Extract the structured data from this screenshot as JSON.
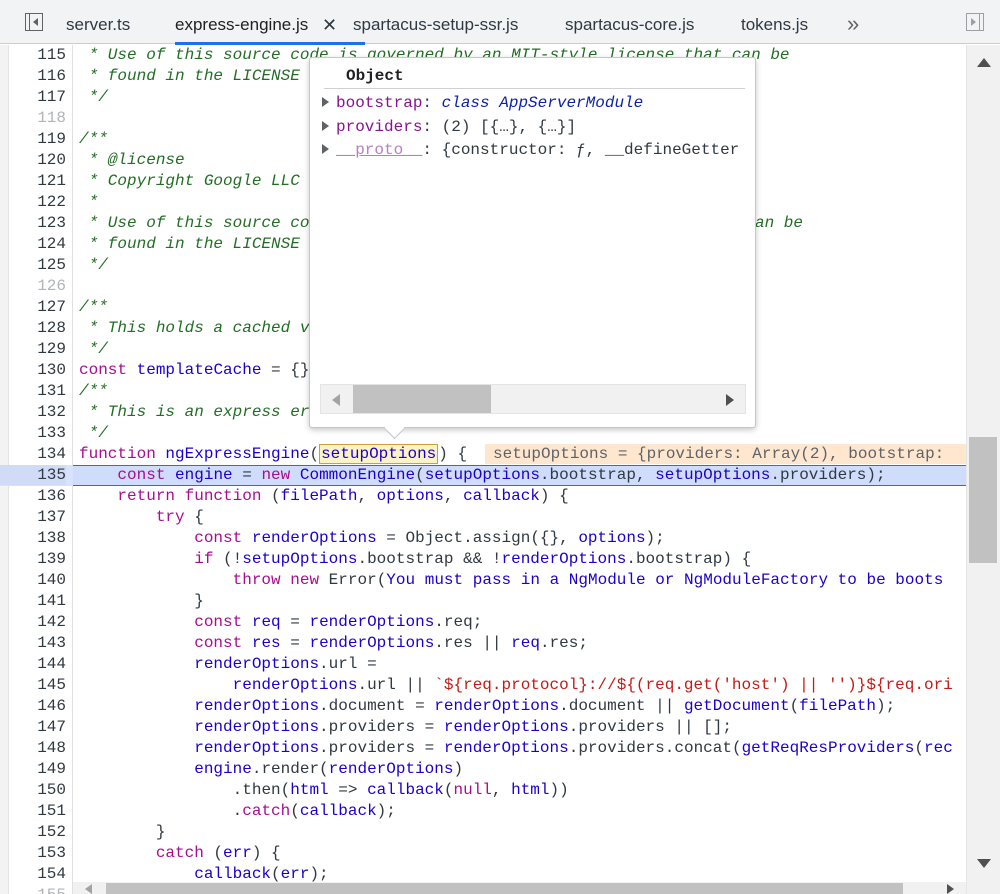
{
  "tabs": [
    {
      "label": "server.ts"
    },
    {
      "label": "express-engine.js",
      "active": true
    },
    {
      "label": "spartacus-setup-ssr.js"
    },
    {
      "label": "spartacus-core.js"
    },
    {
      "label": "tokens.js"
    }
  ],
  "tabbar": {
    "close_glyph": "✕",
    "more_glyph": "»",
    "left_toggle_icon": "toggle-navigator-icon",
    "right_toggle_icon": "toggle-debugger-icon"
  },
  "popover": {
    "title": "Object",
    "props": [
      {
        "key": "bootstrap",
        "sep": ": ",
        "type": "class",
        "value": " AppServerModule"
      },
      {
        "key": "providers",
        "sep": ": ",
        "type": "",
        "value": "(2) [{…}, {…}]"
      },
      {
        "key": "__proto__",
        "sep": ": ",
        "type": "",
        "value": "{constructor: ƒ, __defineGetter"
      }
    ]
  },
  "inline_value": "setupOptions = {providers: Array(2), bootstrap: ",
  "hover_word": "setupOptions",
  "lines": [
    {
      "n": "115",
      "t": " * Use of this source code is governed by an MIT-style license that can be"
    },
    {
      "n": "116",
      "t": " * found in the LICENSE"
    },
    {
      "n": "117",
      "t": " */"
    },
    {
      "n": "118",
      "t": ""
    },
    {
      "n": "119",
      "t": "/**"
    },
    {
      "n": "120",
      "t": " * @license"
    },
    {
      "n": "121",
      "t": " * Copyright Google LLC"
    },
    {
      "n": "122",
      "t": " *"
    },
    {
      "n": "123",
      "t": " * Use of this source co",
      "t2": "an be"
    },
    {
      "n": "124",
      "t": " * found in the LICENSE"
    },
    {
      "n": "125",
      "t": " */"
    },
    {
      "n": "126",
      "t": ""
    },
    {
      "n": "127",
      "t": "/**"
    },
    {
      "n": "128",
      "t": " * This holds a cached v"
    },
    {
      "n": "129",
      "t": " */"
    },
    {
      "n": "130",
      "t": "const templateCache = {}"
    },
    {
      "n": "131",
      "t": "/**"
    },
    {
      "n": "132",
      "t": " * This is an express er"
    },
    {
      "n": "133",
      "t": " */"
    },
    {
      "n": "134",
      "t": "function ngExpressEngine(setupOptions) {"
    },
    {
      "n": "135",
      "t": "    const engine = new CommonEngine(setupOptions.bootstrap, setupOptions.providers);"
    },
    {
      "n": "136",
      "t": "    return function (filePath, options, callback) {"
    },
    {
      "n": "137",
      "t": "        try {"
    },
    {
      "n": "138",
      "t": "            const renderOptions = Object.assign({}, options);"
    },
    {
      "n": "139",
      "t": "            if (!setupOptions.bootstrap && !renderOptions.bootstrap) {"
    },
    {
      "n": "140",
      "t": "                throw new Error('You must pass in a NgModule or NgModuleFactory to be boots"
    },
    {
      "n": "141",
      "t": "            }"
    },
    {
      "n": "142",
      "t": "            const req = renderOptions.req;"
    },
    {
      "n": "143",
      "t": "            const res = renderOptions.res || req.res;"
    },
    {
      "n": "144",
      "t": "            renderOptions.url ="
    },
    {
      "n": "145",
      "t": "                renderOptions.url || `${req.protocol}://${(req.get('host') || '')}${req.ori"
    },
    {
      "n": "146",
      "t": "            renderOptions.document = renderOptions.document || getDocument(filePath);"
    },
    {
      "n": "147",
      "t": "            renderOptions.providers = renderOptions.providers || [];"
    },
    {
      "n": "148",
      "t": "            renderOptions.providers = renderOptions.providers.concat(getReqResProviders(rec"
    },
    {
      "n": "149",
      "t": "            engine.render(renderOptions)"
    },
    {
      "n": "150",
      "t": "                .then(html => callback(null, html))"
    },
    {
      "n": "151",
      "t": "                .catch(callback);"
    },
    {
      "n": "152",
      "t": "        }"
    },
    {
      "n": "153",
      "t": "        catch (err) {"
    },
    {
      "n": "154",
      "t": "            callback(err);"
    },
    {
      "n": "155",
      "t": ""
    }
  ]
}
